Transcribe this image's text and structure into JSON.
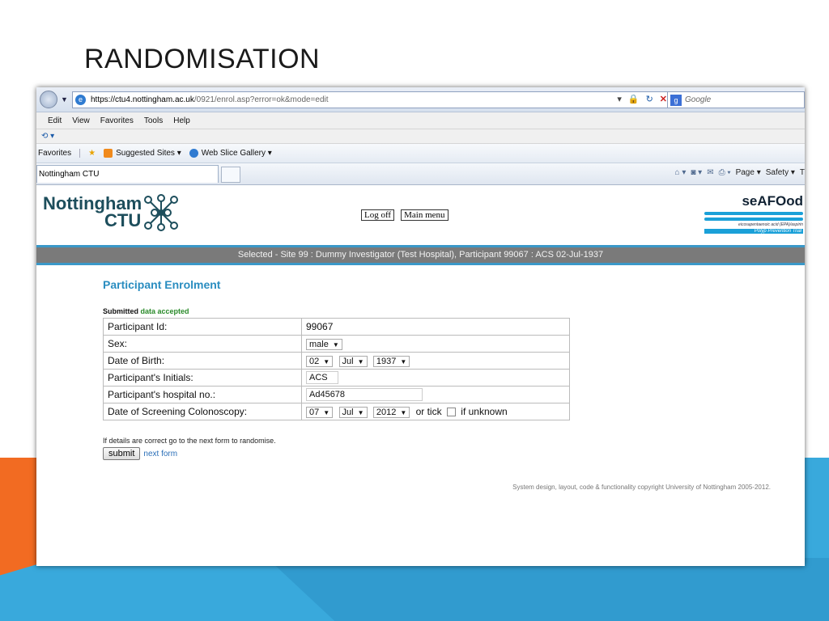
{
  "slide": {
    "title": "RANDOMISATION"
  },
  "browser": {
    "url_host": "https://ctu4.nottingham.ac.uk",
    "url_path": "/0921/enrol.asp?error=ok&mode=edit",
    "search_placeholder": "Google",
    "menu": [
      "Edit",
      "View",
      "Favorites",
      "Tools",
      "Help"
    ],
    "favorites_label": "Favorites",
    "suggested_sites": "Suggested Sites ▾",
    "web_slice_gallery": "Web Slice Gallery ▾",
    "tab_title": "Nottingham CTU",
    "toolbar": {
      "page": "Page ▾",
      "safety": "Safety ▾",
      "tools": "T"
    }
  },
  "header": {
    "logo_line1": "Nottingham",
    "logo_line2": "CTU",
    "logoff": "Log off",
    "main_menu": "Main menu",
    "seafood_title": "seAFOod",
    "seafood_sub": "eicosapentaenoic acid (EPA)/aspirin",
    "seafood_bar": "Polyp Prevention Trial"
  },
  "status": {
    "selected": "Selected - Site 99 : Dummy Investigator (Test Hospital), Participant 99067 : ACS 02-Jul-1937"
  },
  "form": {
    "heading": "Participant Enrolment",
    "submitted_label": "Submitted",
    "submitted_status": "data accepted",
    "participant_id_label": "Participant Id:",
    "participant_id": "99067",
    "sex_label": "Sex:",
    "sex": "male",
    "dob_label": "Date of Birth:",
    "dob_day": "02",
    "dob_month": "Jul",
    "dob_year": "1937",
    "initials_label": "Participant's Initials:",
    "initials": "ACS",
    "hospital_no_label": "Participant's hospital no.:",
    "hospital_no": "Ad45678",
    "screening_label": "Date of Screening Colonoscopy:",
    "scr_day": "07",
    "scr_month": "Jul",
    "scr_year": "2012",
    "or_tick": "or tick",
    "if_unknown": "if unknown",
    "note": "If details are correct go to the next form to randomise.",
    "submit": "submit",
    "next_form": "next form"
  },
  "footer": {
    "copyright": "System design, layout, code & functionality copyright University of Nottingham 2005-2012."
  }
}
